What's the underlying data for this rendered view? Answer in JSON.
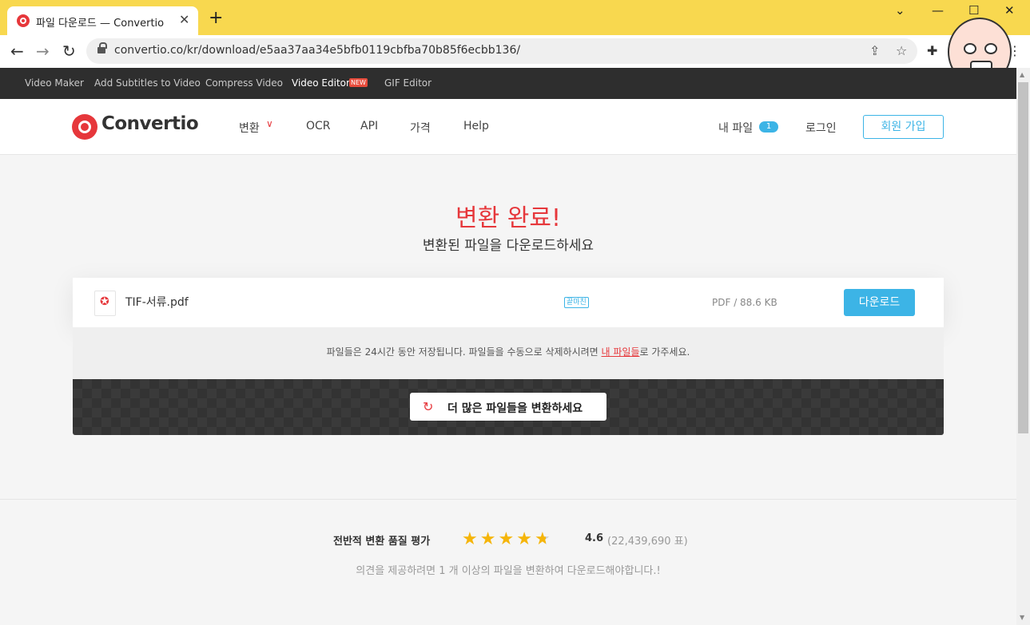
{
  "browser": {
    "tab_title": "파일 다운로드 — Convertio",
    "tab_close": "✕",
    "new_tab": "+",
    "window": {
      "minimize": "⌄",
      "restore": "—",
      "maximize": "☐",
      "close": "✕"
    },
    "url": "convertio.co/kr/download/e5aa37aa34e5bfb0119cbfba70b85f6ecbb136/",
    "back": "←",
    "forward": "→",
    "reload": "↻",
    "share_icon": "⇪",
    "bookmark_icon": "☆",
    "extensions_icon": "✚",
    "menu_icon": "⋮"
  },
  "topbar": {
    "items": [
      "Video Maker",
      "Add Subtitles to Video",
      "Compress Video",
      "Video Editor",
      "GIF Editor"
    ],
    "new_badge": "NEW"
  },
  "header": {
    "logo": "Convertio",
    "nav": [
      "변환",
      "OCR",
      "API",
      "가격",
      "Help"
    ],
    "chevron": "∨",
    "my_files": "내 파일",
    "my_files_count": "1",
    "login": "로그인",
    "signup": "회원 가입"
  },
  "hero": {
    "title": "변환 완료!",
    "subtitle": "변환된 파일을 다운로드하세요"
  },
  "file": {
    "icon": "✪",
    "name": "TIF-서류.pdf",
    "status": "끝마친",
    "size": "PDF / 88.6 KB",
    "download": "다운로드"
  },
  "notice": {
    "before": "파일들은 24시간 동안 저장됩니다. 파일들을 수동으로 삭제하시려면 ",
    "link": "내 파일들",
    "after": "로 가주세요."
  },
  "convert_more": {
    "icon": "↻",
    "label": "더 많은 파일들을 변환하세요"
  },
  "rating": {
    "label": "전반적 변환 품질 평가",
    "stars_glyphs": "★★★★★",
    "stars_value": 4.6,
    "score": "4.6",
    "votes": "(22,439,690 표)",
    "note": "의견을 제공하려면 1 개 이상의 파일을 변환하여 다운로드해야합니다.!"
  }
}
